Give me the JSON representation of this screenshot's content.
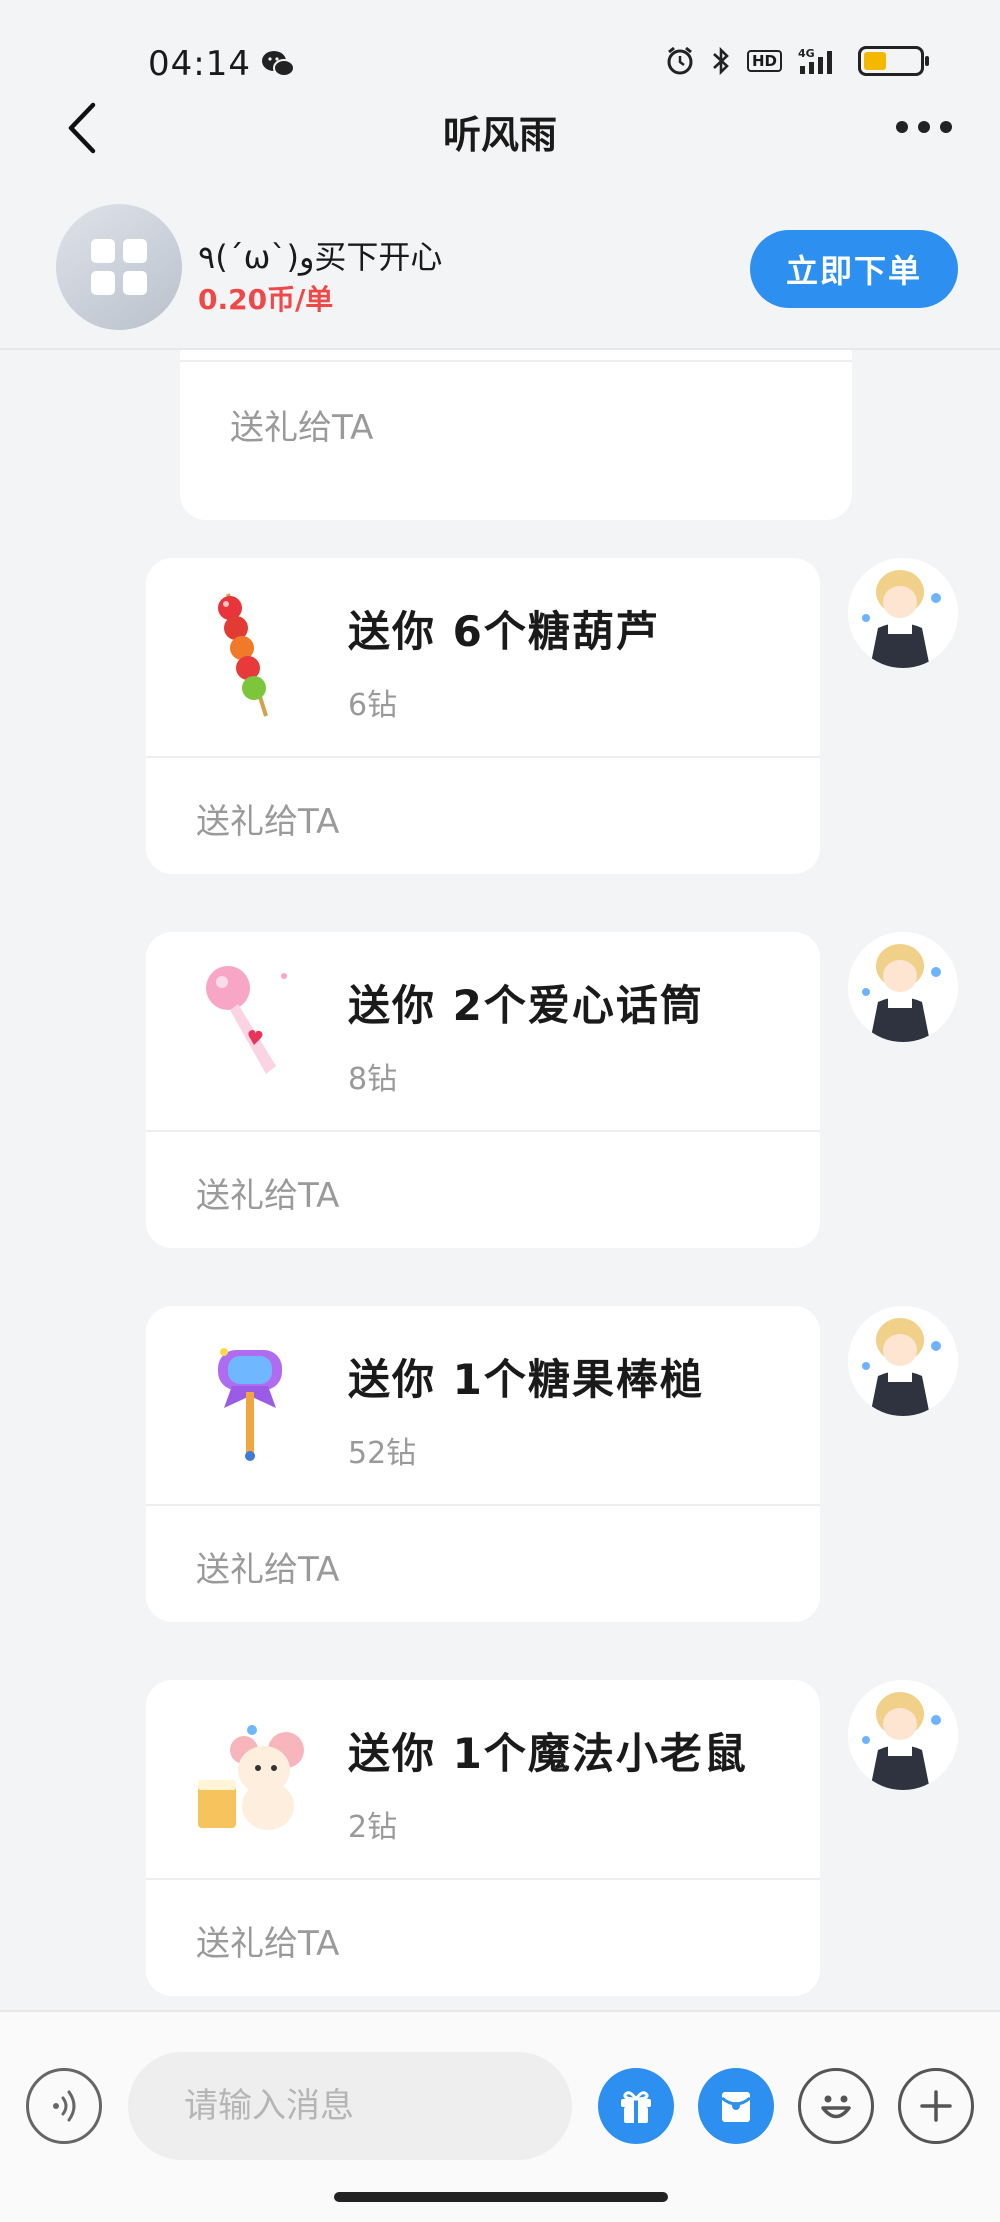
{
  "status_bar": {
    "time": "04:14",
    "network": "4G",
    "hd": "HD"
  },
  "header": {
    "title": "听风雨"
  },
  "service": {
    "name": "٩(ˊωˋ)و买下开心",
    "price": "0.20币/单",
    "order_button": "立即下单"
  },
  "chat": {
    "partial_message": {
      "send_gift_label": "送礼给TA"
    },
    "messages": [
      {
        "title": "送你 6个糖葫芦",
        "price": "6钻",
        "send_gift_label": "送礼给TA",
        "gift_icon": "candied-haws-icon"
      },
      {
        "title": "送你 2个爱心话筒",
        "price": "8钻",
        "send_gift_label": "送礼给TA",
        "gift_icon": "heart-microphone-icon"
      },
      {
        "title": "送你 1个糖果棒槌",
        "price": "52钻",
        "send_gift_label": "送礼给TA",
        "gift_icon": "candy-mallet-icon"
      },
      {
        "title": "送你 1个魔法小老鼠",
        "price": "2钻",
        "send_gift_label": "送礼给TA",
        "gift_icon": "magic-mouse-icon"
      }
    ]
  },
  "input_bar": {
    "placeholder": "请输入消息"
  },
  "colors": {
    "accent": "#2d8ff0",
    "price_red": "#f04848",
    "background": "#f3f4f6"
  }
}
